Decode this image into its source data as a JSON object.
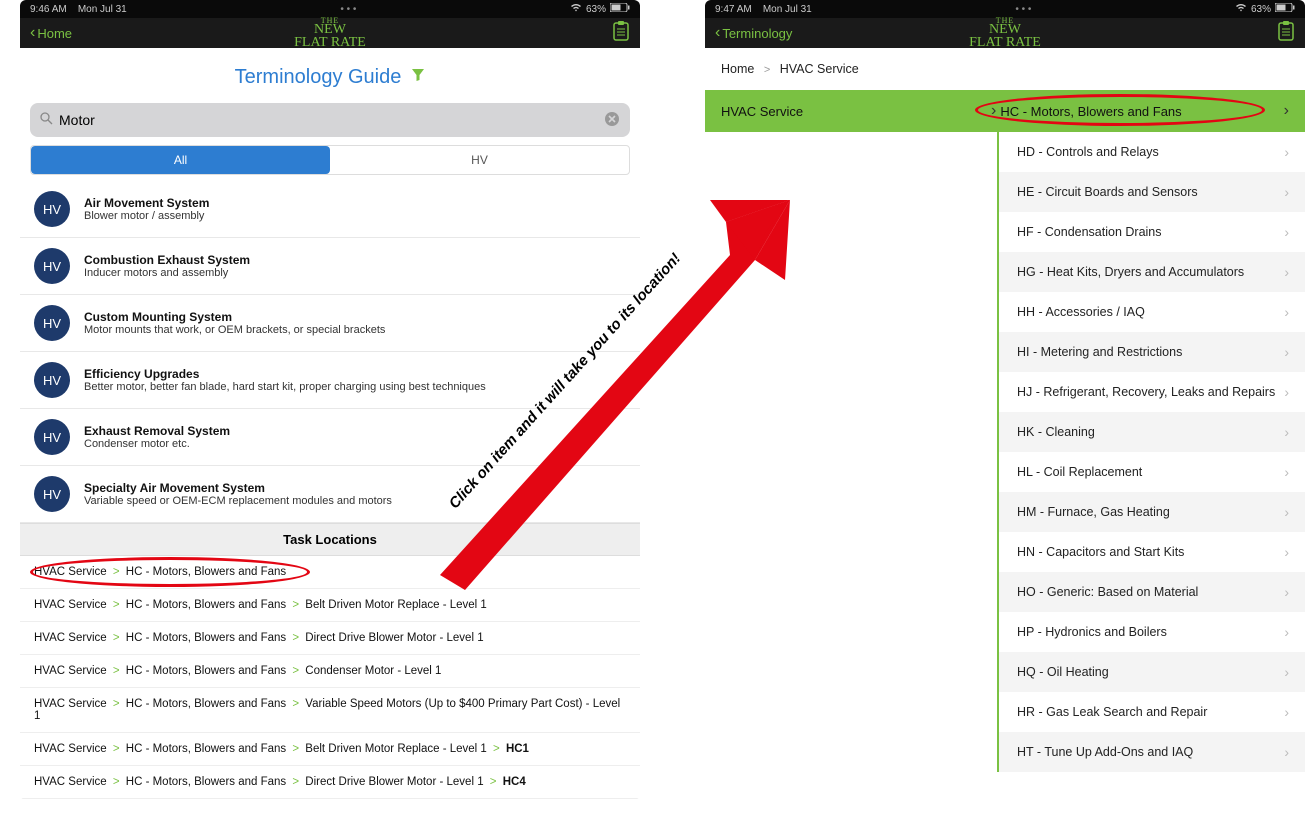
{
  "left": {
    "status": {
      "time": "9:46 AM",
      "date": "Mon Jul 31",
      "dots": "• • •",
      "battery": "63%"
    },
    "back": "Home",
    "logo": {
      "the": "THE",
      "new": "NEW",
      "flat": "FLAT RATE"
    },
    "title": "Terminology Guide",
    "search_value": "Motor",
    "tabs": {
      "all": "All",
      "hv": "HV"
    },
    "results": [
      {
        "badge": "HV",
        "title": "Air Movement System",
        "sub": "Blower motor / assembly"
      },
      {
        "badge": "HV",
        "title": "Combustion Exhaust System",
        "sub": "Inducer motors and assembly"
      },
      {
        "badge": "HV",
        "title": "Custom Mounting System",
        "sub": "Motor mounts that work, or OEM brackets, or special brackets"
      },
      {
        "badge": "HV",
        "title": "Efficiency Upgrades",
        "sub": "Better motor, better fan blade, hard start kit, proper charging using best techniques"
      },
      {
        "badge": "HV",
        "title": "Exhaust Removal System",
        "sub": "Condenser motor etc."
      },
      {
        "badge": "HV",
        "title": "Specialty Air Movement System",
        "sub": "Variable speed or OEM-ECM replacement modules and motors"
      }
    ],
    "section": "Task Locations",
    "tasks": [
      [
        "HVAC Service",
        "HC - Motors, Blowers and Fans"
      ],
      [
        "HVAC Service",
        "HC - Motors, Blowers and Fans",
        "Belt Driven Motor Replace - Level 1"
      ],
      [
        "HVAC Service",
        "HC - Motors, Blowers and Fans",
        "Direct Drive Blower Motor - Level 1"
      ],
      [
        "HVAC Service",
        "HC - Motors, Blowers and Fans",
        "Condenser Motor - Level 1"
      ],
      [
        "HVAC Service",
        "HC - Motors, Blowers and Fans",
        "Variable Speed Motors (Up to $400 Primary Part Cost) - Level 1"
      ],
      [
        "HVAC Service",
        "HC - Motors, Blowers and Fans",
        "Belt Driven Motor Replace - Level 1",
        "HC1"
      ],
      [
        "HVAC Service",
        "HC - Motors, Blowers and Fans",
        "Direct Drive Blower Motor - Level 1",
        "HC4"
      ]
    ]
  },
  "right": {
    "status": {
      "time": "9:47 AM",
      "date": "Mon Jul 31",
      "dots": "• • •",
      "battery": "63%"
    },
    "back": "Terminology",
    "logo": {
      "the": "THE",
      "new": "NEW",
      "flat": "FLAT RATE"
    },
    "breadcrumb": [
      "Home",
      "HVAC Service"
    ],
    "cat_left": "HVAC Service",
    "cat_right": "HC - Motors, Blowers and Fans",
    "items": [
      "HD - Controls and Relays",
      "HE - Circuit Boards and Sensors",
      "HF - Condensation Drains",
      "HG - Heat Kits, Dryers and Accumulators",
      "HH - Accessories / IAQ",
      "HI - Metering and Restrictions",
      "HJ - Refrigerant, Recovery, Leaks and Repairs",
      "HK - Cleaning",
      "HL - Coil Replacement",
      "HM - Furnace, Gas Heating",
      "HN - Capacitors and Start Kits",
      "HO - Generic: Based on Material",
      "HP - Hydronics and Boilers",
      "HQ - Oil Heating",
      "HR - Gas Leak Search and Repair",
      "HT - Tune Up Add-Ons and IAQ"
    ]
  },
  "annotation": "Click on item and it will take you to its location!"
}
